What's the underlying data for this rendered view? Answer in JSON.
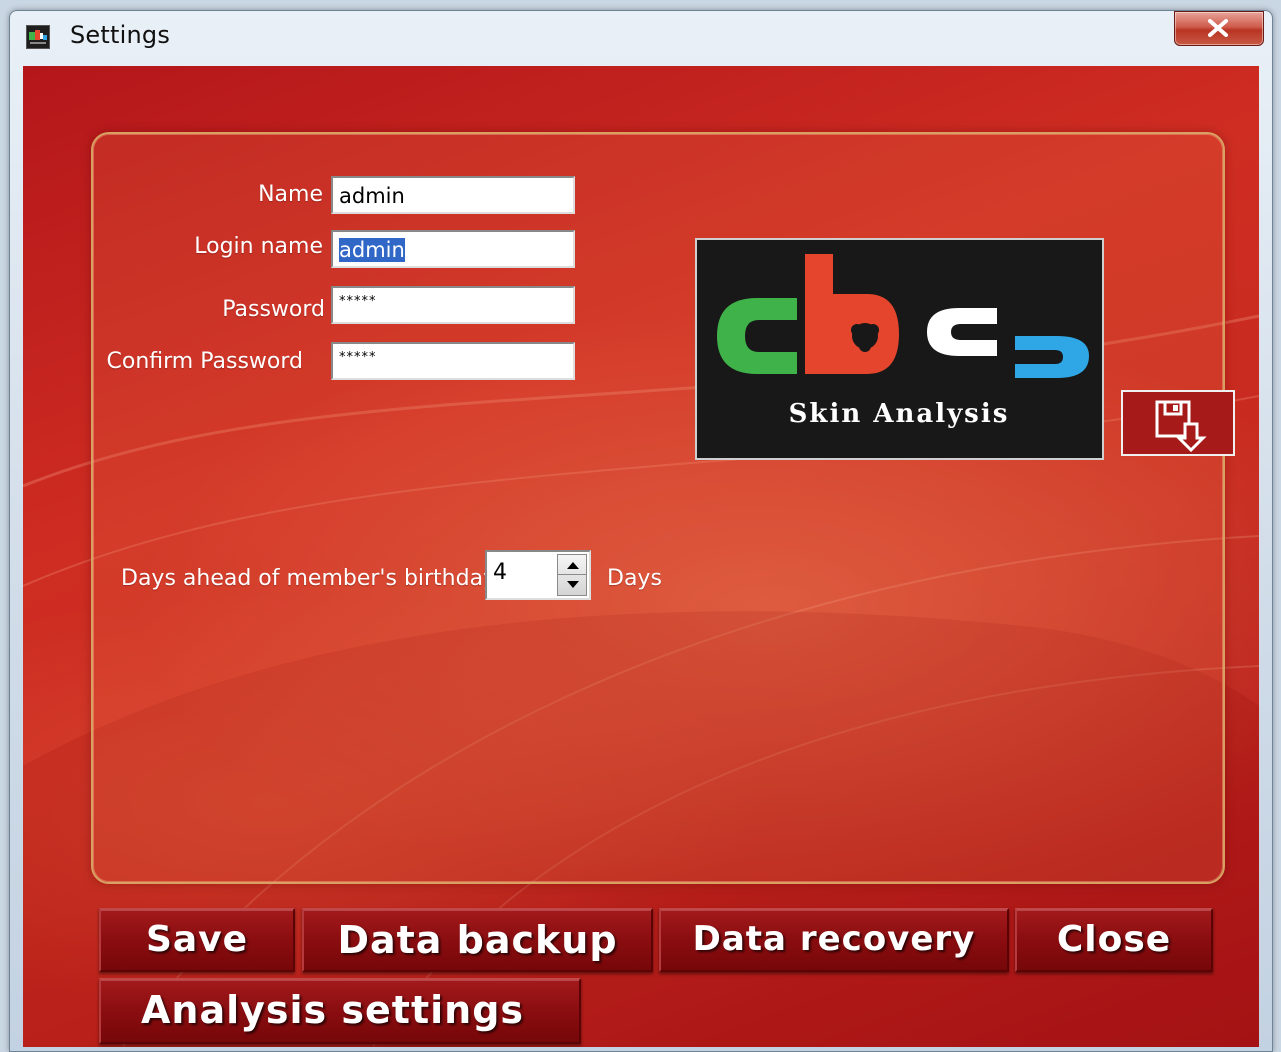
{
  "window": {
    "title": "Settings",
    "icon": "cbc-app-icon",
    "close_icon": "close-icon"
  },
  "form": {
    "name_label": "Name",
    "name_value": "admin",
    "login_label": "Login name",
    "login_value": "admin",
    "password_label": "Password",
    "password_value": "*****",
    "confirm_label": "Confirm Password",
    "confirm_value": "*****",
    "birthday_label": "Days ahead of member's birthday",
    "birthday_value": "4",
    "birthday_unit": "Days"
  },
  "logo": {
    "caption": "Skin Analysis",
    "letters": [
      "c",
      "b",
      "c",
      "s"
    ],
    "colors": [
      "#3fb24a",
      "#e4452c",
      "#ffffff",
      "#2fa7e6"
    ]
  },
  "logo_save_icon": "save-download-icon",
  "buttons": {
    "save": "Save",
    "backup": "Data backup",
    "recovery": "Data recovery",
    "close": "Close",
    "analysis": "Analysis settings"
  },
  "colors": {
    "background": "#c72a1f",
    "button": "#8a0d10",
    "panel_border": "#d9a062"
  }
}
